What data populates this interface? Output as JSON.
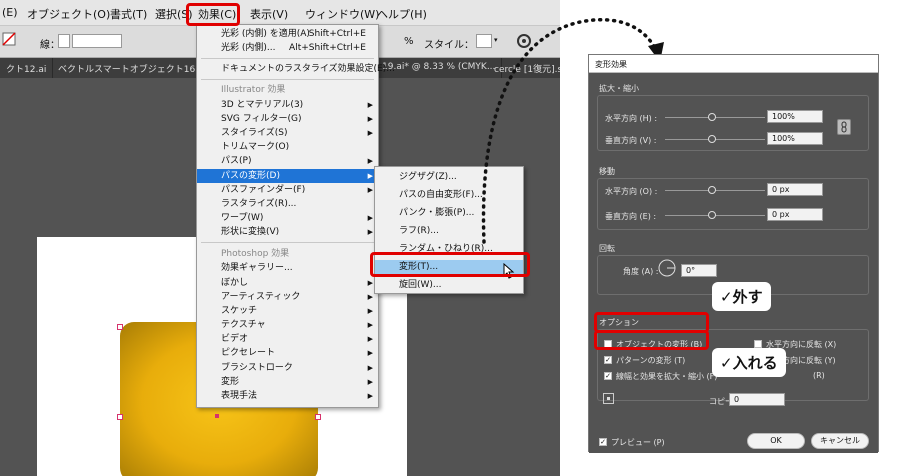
{
  "menubar": {
    "items": [
      "(E)",
      "オブジェクト(O)",
      "書式(T)",
      "選択(S)",
      "効果(C)",
      "表示(V)",
      "ウィンドウ(W)",
      "ヘルプ(H)"
    ]
  },
  "control_bar": {
    "stroke_label": "線：",
    "percent": "%",
    "style_label": "スタイル："
  },
  "tabs": [
    "クト12.ai",
    "ベクトルスマートオブジェクト16.ai",
    "19.ai* @ 8.33 % (CMYK...",
    "cercle [1復元].svg"
  ],
  "effect_menu": {
    "items": [
      {
        "label": "光彩 (内側) を適用(A)",
        "shortcut": "Shift+Ctrl+E"
      },
      {
        "label": "光彩 (内側)...",
        "shortcut": "Alt+Shift+Ctrl+E"
      },
      {
        "label": "ドキュメントのラスタライズ効果設定(E)..."
      },
      {
        "label": "Illustrator 効果",
        "disabled": true
      },
      {
        "label": "3D とマテリアル(3)",
        "submenu": true
      },
      {
        "label": "SVG フィルター(G)",
        "submenu": true
      },
      {
        "label": "スタイライズ(S)",
        "submenu": true
      },
      {
        "label": "トリムマーク(O)"
      },
      {
        "label": "パス(P)",
        "submenu": true
      },
      {
        "label": "パスの変形(D)",
        "submenu": true,
        "highlighted": true
      },
      {
        "label": "パスファインダー(F)",
        "submenu": true
      },
      {
        "label": "ラスタライズ(R)..."
      },
      {
        "label": "ワープ(W)",
        "submenu": true
      },
      {
        "label": "形状に変換(V)",
        "submenu": true
      },
      {
        "label": "Photoshop 効果",
        "disabled": true
      },
      {
        "label": "効果ギャラリー..."
      },
      {
        "label": "ぼかし",
        "submenu": true
      },
      {
        "label": "アーティスティック",
        "submenu": true
      },
      {
        "label": "スケッチ",
        "submenu": true
      },
      {
        "label": "テクスチャ",
        "submenu": true
      },
      {
        "label": "ビデオ",
        "submenu": true
      },
      {
        "label": "ピクセレート",
        "submenu": true
      },
      {
        "label": "ブラシストローク",
        "submenu": true
      },
      {
        "label": "変形",
        "submenu": true
      },
      {
        "label": "表現手法",
        "submenu": true
      }
    ]
  },
  "submenu": {
    "items": [
      {
        "label": "ジグザグ(Z)..."
      },
      {
        "label": "パスの自由変形(F)..."
      },
      {
        "label": "パンク・膨張(P)..."
      },
      {
        "label": "ラフ(R)..."
      },
      {
        "label": "ランダム・ひねり(R)..."
      },
      {
        "label": "変形(T)...",
        "highlighted": true
      },
      {
        "label": "旋回(W)..."
      }
    ]
  },
  "dialog": {
    "title": "変形効果",
    "scale": {
      "title": "拡大・縮小",
      "horizontal_label": "水平方向 (H) :",
      "horizontal_value": "100%",
      "vertical_label": "垂直方向 (V) :",
      "vertical_value": "100%"
    },
    "move": {
      "title": "移動",
      "horizontal_label": "水平方向 (O) :",
      "horizontal_value": "0 px",
      "vertical_label": "垂直方向 (E) :",
      "vertical_value": "0 px"
    },
    "rotate": {
      "title": "回転",
      "angle_label": "角度 (A) :",
      "angle_value": "0°"
    },
    "options": {
      "title": "オプション",
      "transform_objects": {
        "label": "オブジェクトの変形 (B)",
        "checked": false
      },
      "transform_patterns": {
        "label": "パターンの変形 (T)",
        "checked": true
      },
      "scale_strokes": {
        "label": "線幅と効果を拡大・縮小 (F)",
        "checked": true
      },
      "reflect_x": {
        "label": "水平方向に反転 (X)",
        "checked": false
      },
      "reflect_y": {
        "label": "垂直方向に反転 (Y)",
        "checked": false
      },
      "random": {
        "label": "(R)"
      },
      "copies_label": "コピー",
      "copies_value": "0"
    },
    "preview": {
      "label": "プレビュー (P)",
      "checked": true
    },
    "ok_label": "OK",
    "cancel_label": "キャンセル"
  },
  "callouts": {
    "uncheck": "✓外す",
    "check": "✓入れる"
  },
  "colors": {
    "highlight_box": "#e00000",
    "menu_highlight": "#1f74d6",
    "shape_fill": "#f2b90f"
  }
}
